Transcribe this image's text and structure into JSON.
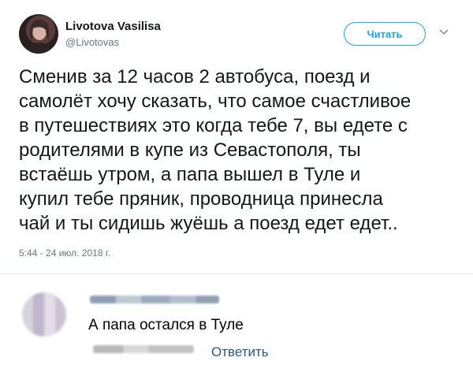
{
  "tweet": {
    "display_name": "Livotova Vasilisa",
    "handle": "@Livotovas",
    "follow_label": "Читать",
    "text": "Сменив за 12 часов 2 автобуса, поезд и\nсамолёт хочу сказать, что самое счастливое\nв путешествиях это когда тебе 7, вы едете с\nродителями в купе из Севастополя, ты\nвстаёшь утром, а папа вышел в Туле и\nкупил тебе пряник, проводница принесла\nчай и ты сидишь жуёшь а поезд едет едет..",
    "timestamp": "5:44 - 24 июл. 2018 г.",
    "colors": {
      "accent": "#1da1f2",
      "secondary_text": "#657786"
    },
    "icons": [
      "avatar",
      "chevron-down-icon"
    ]
  },
  "comment": {
    "text": "А папа остался в Туле",
    "reply_label": "Ответить",
    "colors": {
      "link": "#2a5885"
    }
  }
}
